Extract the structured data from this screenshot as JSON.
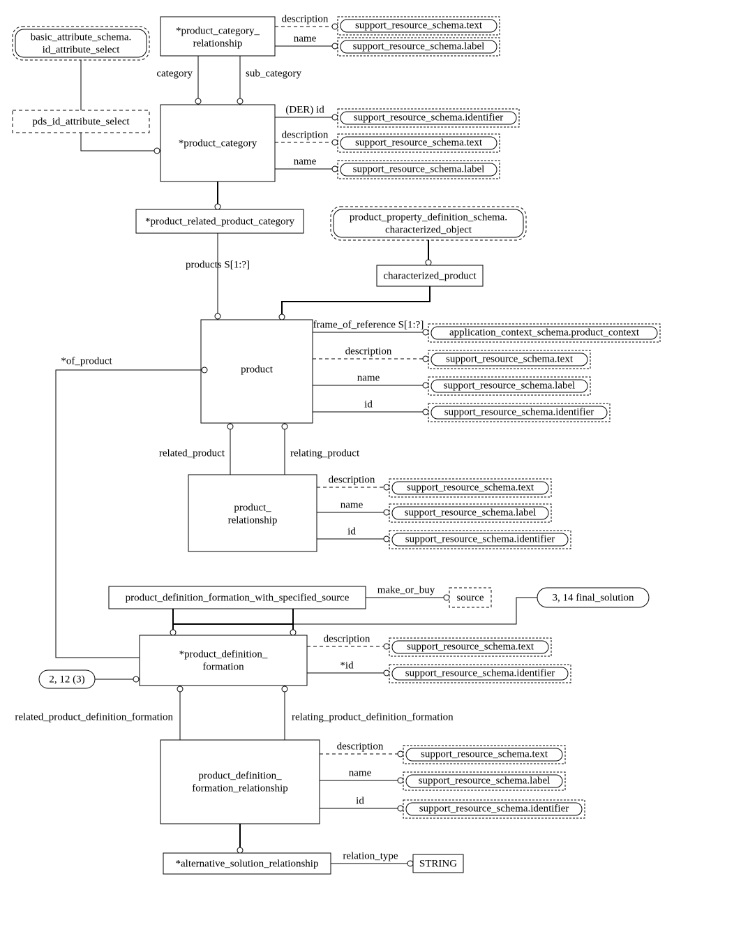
{
  "entities": {
    "basic_attr_schema_l1": "basic_attribute_schema.",
    "basic_attr_schema_l2": "id_attribute_select",
    "pds_id_attribute_select": "pds_id_attribute_select",
    "product_category_rel_l1": "*product_category_",
    "product_category_rel_l2": "relationship",
    "product_category": "*product_category",
    "product_related_product_category": "*product_related_product_category",
    "product_property_def_l1": "product_property_definition_schema.",
    "product_property_def_l2": "characterized_object",
    "characterized_product": "characterized_product",
    "product": "product",
    "product_relationship_l1": "product_",
    "product_relationship_l2": "relationship",
    "pdf_with_source": "product_definition_formation_with_specified_source",
    "source": "source",
    "product_definition_formation_l1": "*product_definition_",
    "product_definition_formation_l2": "formation",
    "pdf_rel_l1": "product_definition_",
    "pdf_rel_l2": "formation_relationship",
    "alternative_solution_relationship": "*alternative_solution_relationship",
    "string": "STRING"
  },
  "types": {
    "srs_text": "support_resource_schema.text",
    "srs_label": "support_resource_schema.label",
    "srs_identifier": "support_resource_schema.identifier",
    "app_ctx_product_context": "application_context_schema.product_context"
  },
  "rules": {
    "r2_12_3": "2, 12 (3)",
    "r3_14": "3, 14 final_solution"
  },
  "attrs": {
    "description": "description",
    "name": "name",
    "category": "category",
    "sub_category": "sub_category",
    "der_id": "(DER) id",
    "products": "products S[1:?]",
    "frame_of_reference": "frame_of_reference S[1:?]",
    "id": "id",
    "star_id": "*id",
    "related_product": "related_product",
    "relating_product": "relating_product",
    "of_product": "*of_product",
    "make_or_buy": "make_or_buy",
    "related_pdf": "related_product_definition_formation",
    "relating_pdf": "relating_product_definition_formation",
    "relation_type": "relation_type"
  }
}
